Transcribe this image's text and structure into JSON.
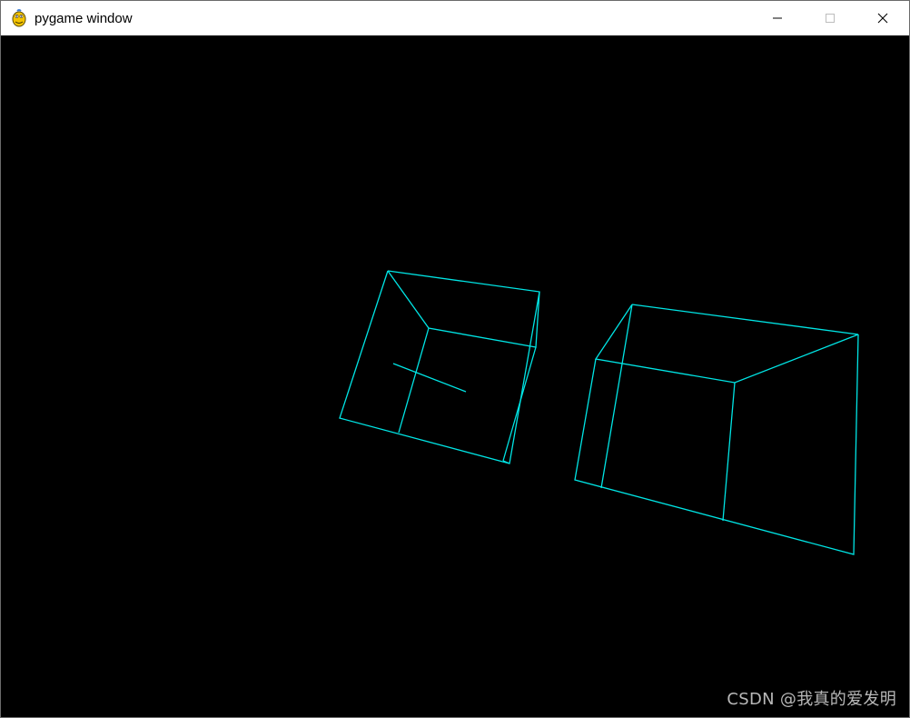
{
  "window": {
    "title": "pygame window",
    "icon": "pygame-snake-icon",
    "controls": {
      "minimize": "minimize-icon",
      "maximize": "maximize-icon",
      "close": "close-icon"
    }
  },
  "scene": {
    "background": "#000000",
    "line_color": "#00e5e5",
    "shapes": [
      "wireframe-cube-left",
      "wireframe-cube-right"
    ]
  },
  "watermark": "CSDN @我真的爱发明"
}
